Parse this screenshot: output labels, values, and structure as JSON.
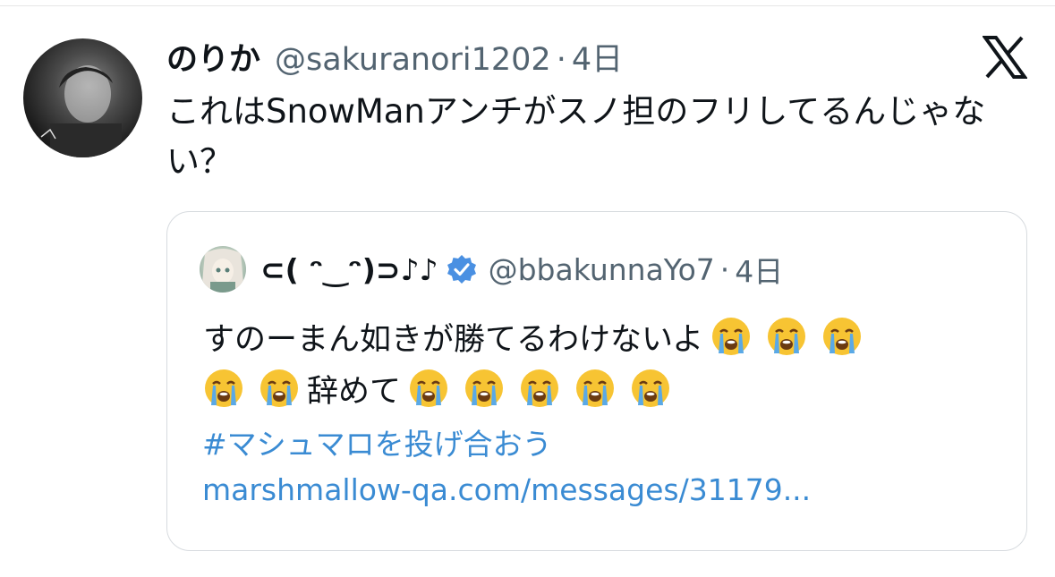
{
  "tweet": {
    "display_name": "のりか",
    "handle": "@sakuranori1202",
    "separator": "·",
    "time": "4日",
    "text": "これはSnowManアンチがスノ担のフリしてるんじゃない？",
    "logo_icon": "x-logo-icon"
  },
  "quote": {
    "display_name": "⊂( ᵔ‿ᵔ)⊃♪♪",
    "verified": true,
    "handle": "@bbakunnaYo7",
    "separator": "·",
    "time": "4日",
    "text_part1": "すのーまん如きが勝てるわけないよ",
    "text_part2": "辞めて",
    "emoji_name": "loudly-crying-face",
    "hashtag": "#マシュマロを投げ合おう",
    "link": "marshmallow-qa.com/messages/31179..."
  },
  "colors": {
    "link": "#3a8bd3",
    "secondary_text": "#536471",
    "verified_badge": "#4a90e2",
    "border": "#d7dbdf"
  }
}
